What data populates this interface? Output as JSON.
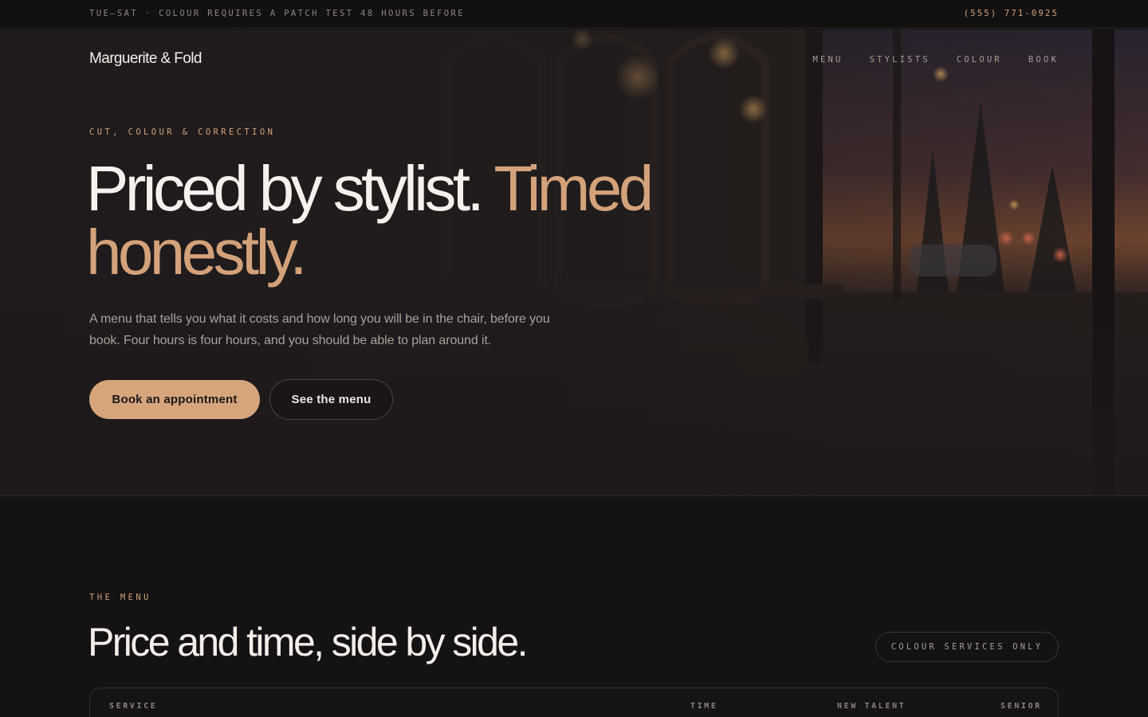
{
  "topbar": {
    "notice": "TUE–SAT · COLOUR REQUIRES A PATCH TEST 48 HOURS BEFORE",
    "phone": "(555) 771-0925"
  },
  "header": {
    "brand": "Marguerite & Fold",
    "nav": [
      "MENU",
      "STYLISTS",
      "COLOUR",
      "BOOK"
    ]
  },
  "hero": {
    "eyebrow": "CUT, COLOUR & CORRECTION",
    "headline_white": "Priced by stylist.",
    "headline_accent": "Timed honestly.",
    "lede": "A menu that tells you what it costs and how long you will be in the chair, before you book. Four hours is four hours, and you should be able to plan around it.",
    "primary_cta": "Book an appointment",
    "secondary_cta": "See the menu"
  },
  "menu_section": {
    "label": "THE MENU",
    "title": "Price and time, side by side.",
    "filter": "COLOUR SERVICES ONLY",
    "columns": [
      "SERVICE",
      "TIME",
      "NEW TALENT",
      "SENIOR"
    ]
  },
  "colors": {
    "accent": "#d3a27a",
    "background": "#141213",
    "text": "#efe9e4"
  }
}
